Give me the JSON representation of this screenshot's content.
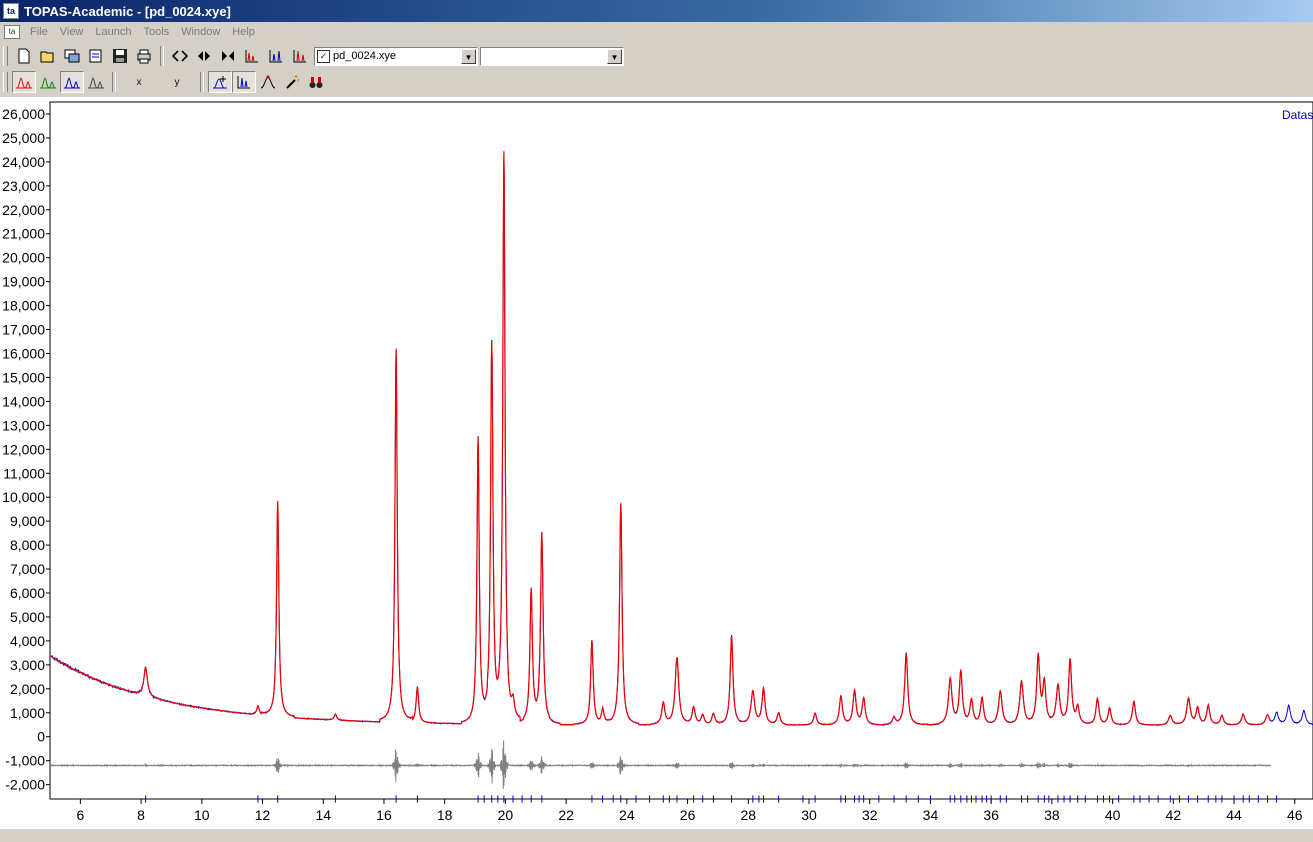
{
  "window": {
    "title": "TOPAS-Academic - [pd_0024.xye]",
    "app_icon": "ta"
  },
  "menu": [
    "File",
    "View",
    "Launch",
    "Tools",
    "Window",
    "Help"
  ],
  "toolbar": {
    "dataset_combo": "pd_0024.xye",
    "dataset_checked": true,
    "second_combo": "",
    "x_label": "x",
    "y_label": "y"
  },
  "plot": {
    "legend_text": "Datas",
    "colors": {
      "observed": "#0000cc",
      "calculated": "#ee0000",
      "difference": "#808080",
      "ticks": "#0000cc"
    }
  },
  "chart_data": {
    "type": "line",
    "xlim": [
      5,
      46.6
    ],
    "ylim": [
      -2600,
      26500
    ],
    "x_ticks": [
      6,
      8,
      10,
      12,
      14,
      16,
      18,
      20,
      22,
      24,
      26,
      28,
      30,
      32,
      34,
      36,
      38,
      40,
      42,
      44,
      46
    ],
    "y_ticks": [
      26000,
      25000,
      24000,
      23000,
      22000,
      21000,
      20000,
      19000,
      18000,
      17000,
      16000,
      15000,
      14000,
      13000,
      12000,
      11000,
      10000,
      9000,
      8000,
      7000,
      6000,
      5000,
      4000,
      3000,
      2000,
      1000,
      0,
      -1000,
      -2000
    ],
    "y_tick_labels": [
      "26,000",
      "25,000",
      "24,000",
      "23,000",
      "22,000",
      "21,000",
      "20,000",
      "19,000",
      "18,000",
      "17,000",
      "16,000",
      "15,000",
      "14,000",
      "13,000",
      "12,000",
      "11,000",
      "10,000",
      "9,000",
      "8,000",
      "7,000",
      "6,000",
      "5,000",
      "4,000",
      "3,000",
      "2,000",
      "1,000",
      "0",
      "-1,000",
      "-2,000"
    ],
    "background": {
      "a": 480,
      "b": 2900,
      "tau": 3.6
    },
    "peaks": [
      {
        "x": 8.15,
        "h": 1200,
        "w": 0.07
      },
      {
        "x": 11.85,
        "h": 380,
        "w": 0.05
      },
      {
        "x": 12.5,
        "h": 9000,
        "w": 0.045
      },
      {
        "x": 14.4,
        "h": 250,
        "w": 0.05
      },
      {
        "x": 16.4,
        "h": 15600,
        "w": 0.045
      },
      {
        "x": 17.1,
        "h": 1500,
        "w": 0.05
      },
      {
        "x": 19.1,
        "h": 11800,
        "w": 0.045
      },
      {
        "x": 19.55,
        "h": 15600,
        "w": 0.045
      },
      {
        "x": 19.95,
        "h": 23700,
        "w": 0.045
      },
      {
        "x": 20.25,
        "h": 700,
        "w": 0.06
      },
      {
        "x": 20.85,
        "h": 5500,
        "w": 0.05
      },
      {
        "x": 21.2,
        "h": 7900,
        "w": 0.05
      },
      {
        "x": 22.85,
        "h": 3500,
        "w": 0.05
      },
      {
        "x": 23.2,
        "h": 600,
        "w": 0.05
      },
      {
        "x": 23.8,
        "h": 9200,
        "w": 0.05
      },
      {
        "x": 25.2,
        "h": 900,
        "w": 0.06
      },
      {
        "x": 25.65,
        "h": 2800,
        "w": 0.07
      },
      {
        "x": 26.2,
        "h": 700,
        "w": 0.06
      },
      {
        "x": 26.5,
        "h": 400,
        "w": 0.06
      },
      {
        "x": 26.85,
        "h": 450,
        "w": 0.06
      },
      {
        "x": 27.45,
        "h": 3700,
        "w": 0.055
      },
      {
        "x": 28.15,
        "h": 1400,
        "w": 0.07
      },
      {
        "x": 28.5,
        "h": 1500,
        "w": 0.06
      },
      {
        "x": 29.0,
        "h": 500,
        "w": 0.06
      },
      {
        "x": 30.2,
        "h": 500,
        "w": 0.06
      },
      {
        "x": 31.05,
        "h": 1200,
        "w": 0.06
      },
      {
        "x": 31.5,
        "h": 1400,
        "w": 0.06
      },
      {
        "x": 31.8,
        "h": 1100,
        "w": 0.06
      },
      {
        "x": 32.8,
        "h": 300,
        "w": 0.06
      },
      {
        "x": 33.2,
        "h": 3000,
        "w": 0.06
      },
      {
        "x": 34.65,
        "h": 1900,
        "w": 0.07
      },
      {
        "x": 35.0,
        "h": 2200,
        "w": 0.06
      },
      {
        "x": 35.35,
        "h": 1000,
        "w": 0.06
      },
      {
        "x": 35.7,
        "h": 1100,
        "w": 0.06
      },
      {
        "x": 36.3,
        "h": 1400,
        "w": 0.07
      },
      {
        "x": 37.0,
        "h": 1800,
        "w": 0.07
      },
      {
        "x": 37.55,
        "h": 2800,
        "w": 0.06
      },
      {
        "x": 37.75,
        "h": 1700,
        "w": 0.06
      },
      {
        "x": 38.2,
        "h": 1600,
        "w": 0.07
      },
      {
        "x": 38.6,
        "h": 2700,
        "w": 0.06
      },
      {
        "x": 38.85,
        "h": 700,
        "w": 0.06
      },
      {
        "x": 39.5,
        "h": 1100,
        "w": 0.06
      },
      {
        "x": 39.9,
        "h": 700,
        "w": 0.06
      },
      {
        "x": 40.7,
        "h": 1000,
        "w": 0.06
      },
      {
        "x": 41.9,
        "h": 400,
        "w": 0.07
      },
      {
        "x": 42.5,
        "h": 1100,
        "w": 0.07
      },
      {
        "x": 42.8,
        "h": 700,
        "w": 0.06
      },
      {
        "x": 43.15,
        "h": 800,
        "w": 0.06
      },
      {
        "x": 43.6,
        "h": 400,
        "w": 0.06
      },
      {
        "x": 44.3,
        "h": 450,
        "w": 0.07
      },
      {
        "x": 45.1,
        "h": 400,
        "w": 0.07
      },
      {
        "x": 45.4,
        "h": 500,
        "w": 0.07
      },
      {
        "x": 45.8,
        "h": 800,
        "w": 0.07
      },
      {
        "x": 46.3,
        "h": 600,
        "w": 0.07
      }
    ],
    "calc_end": 45.2,
    "diff_baseline": -1200,
    "reflection_ticks": [
      8.15,
      11.85,
      12.5,
      14.4,
      16.4,
      17.1,
      19.1,
      19.3,
      19.55,
      19.75,
      19.95,
      20.25,
      20.55,
      20.85,
      21.2,
      22.85,
      23.2,
      23.55,
      23.8,
      24.3,
      24.75,
      25.2,
      25.4,
      25.65,
      26.2,
      26.5,
      26.85,
      27.45,
      28.15,
      28.35,
      28.5,
      29.0,
      29.8,
      30.2,
      31.05,
      31.2,
      31.5,
      31.65,
      31.8,
      32.3,
      32.8,
      33.2,
      33.6,
      34.0,
      34.65,
      34.8,
      35.0,
      35.2,
      35.35,
      35.5,
      35.7,
      35.85,
      36.0,
      36.3,
      36.5,
      37.0,
      37.2,
      37.55,
      37.75,
      37.9,
      38.2,
      38.4,
      38.6,
      38.85,
      39.1,
      39.5,
      39.7,
      39.9,
      40.2,
      40.7,
      40.9,
      41.2,
      41.5,
      41.9,
      42.2,
      42.5,
      42.8,
      43.15,
      43.4,
      43.6,
      44.0,
      44.3,
      44.5,
      44.8,
      45.1,
      45.4
    ],
    "series": [
      {
        "values": []
      }
    ]
  }
}
